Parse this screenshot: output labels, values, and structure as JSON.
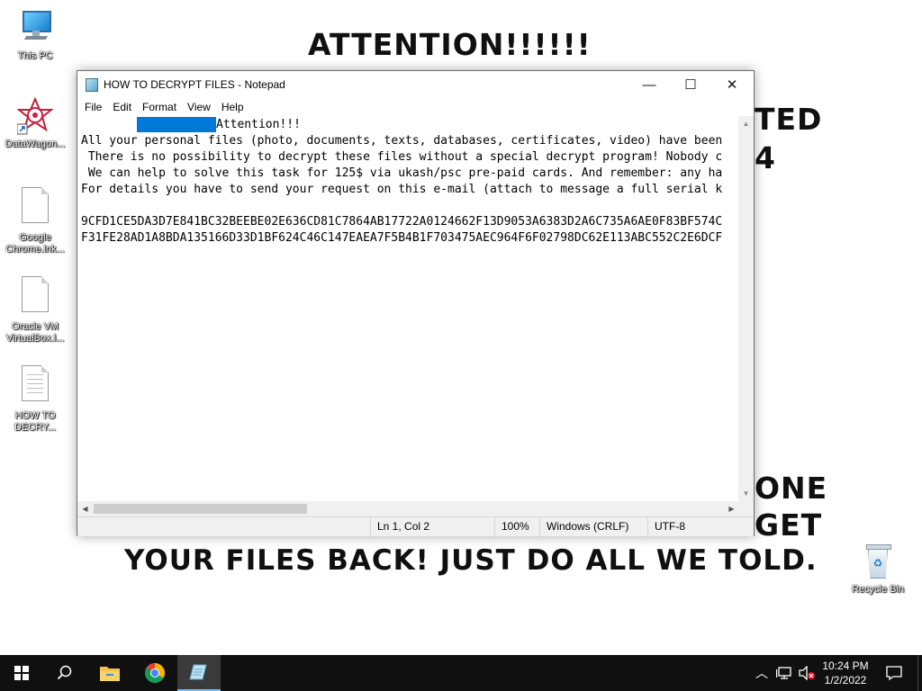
{
  "wallpaper": {
    "title": "ATTENTION!!!!!!",
    "fragment_right_1": "TED",
    "fragment_right_2": "4",
    "fragment_right_3": "ONE",
    "fragment_right_4": "GET",
    "bottom_line": "YOUR FILES BACK! JUST DO ALL WE TOLD."
  },
  "desktop_icons": [
    {
      "label": "This PC",
      "icon": "computer-icon"
    },
    {
      "label": "DataWagon...",
      "icon": "shortcut-icon"
    },
    {
      "label": "Google Chrome.lnk...",
      "icon": "document-icon"
    },
    {
      "label": "Oracle VM VirtualBox.l...",
      "icon": "document-icon"
    },
    {
      "label": "HOW TO DECRY...",
      "icon": "text-file-icon"
    },
    {
      "label": "Recycle Bin",
      "icon": "recycle-bin-icon"
    }
  ],
  "window": {
    "title": "HOW TO DECRYPT FILES - Notepad",
    "controls": {
      "minimize": "—",
      "maximize": "☐",
      "close": "✕"
    },
    "menu": [
      "File",
      "Edit",
      "Format",
      "View",
      "Help"
    ],
    "content": {
      "line1": "Attention!!!",
      "line2": "All your personal files (photo, documents, texts, databases, certificates, video) have been",
      "line3": " There is no possibility to decrypt these files without a special decrypt program! Nobody c",
      "line4": " We can help to solve this task for 125$ via ukash/psc pre-paid cards. And remember: any ha",
      "line5": "For details you have to send your request on this e-mail (attach to message a full serial k",
      "line6": "",
      "line7": "9CFD1CE5DA3D7E841BC32BEEBE02E636CD81C7864AB17722A0124662F13D9053A6383D2A6C735A6AE0F83BF574C",
      "line8": "F31FE28AD1A8BDA135166D33D1BF624C46C147EAEA7F5B4B1F703475AEC964F6F02798DC62E113ABC552C2E6DCF"
    },
    "status": {
      "position": "Ln 1, Col 2",
      "zoom": "100%",
      "line_ending": "Windows (CRLF)",
      "encoding": "UTF-8"
    }
  },
  "taskbar": {
    "apps": [
      {
        "name": "start-icon"
      },
      {
        "name": "search-icon"
      },
      {
        "name": "file-explorer-icon"
      },
      {
        "name": "chrome-icon"
      },
      {
        "name": "notepad-icon"
      }
    ],
    "clock": {
      "time": "10:24 PM",
      "date": "1/2/2022"
    }
  },
  "colors": {
    "selection": "#0078d7",
    "taskbar": "#101010",
    "active_task": "#3a3a3a"
  }
}
